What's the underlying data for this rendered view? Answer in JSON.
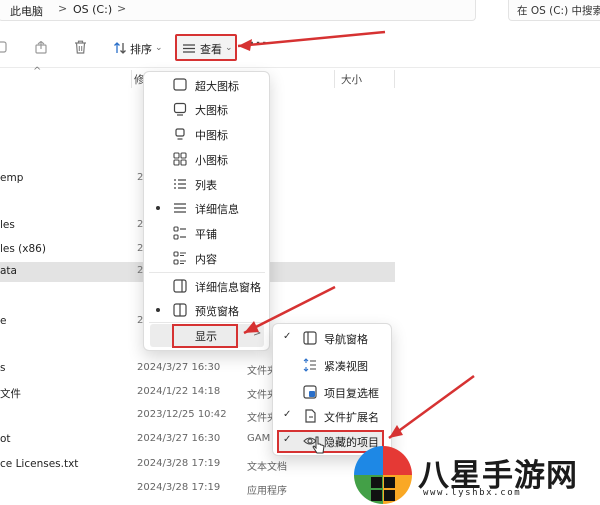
{
  "address": {
    "crumbs": [
      "此电脑",
      "OS (C:)"
    ],
    "separator": ">",
    "search_placeholder": "在 OS (C:) 中搜索"
  },
  "toolbar": {
    "sort_label": "排序",
    "view_label": "查看",
    "more_label": "···"
  },
  "columns": {
    "date_partial": "修",
    "size": "大小"
  },
  "files": [
    {
      "name": "emp",
      "date": "2",
      "type": ""
    },
    {
      "name": "les",
      "date": "2",
      "type": ""
    },
    {
      "name": "les (x86)",
      "date": "2",
      "type": ""
    },
    {
      "name": "ata",
      "date": "2",
      "type": ""
    },
    {
      "name": "e",
      "date": "2",
      "type": ""
    },
    {
      "name": "s",
      "date": "2024/3/27 16:30",
      "type": "文件夹"
    },
    {
      "name": "文件",
      "date": "2024/1/22 14:18",
      "type": "文件夹"
    },
    {
      "name": "",
      "date": "2023/12/25 10:42",
      "type": "文件夹"
    },
    {
      "name": "ot",
      "date": "2024/3/27 16:30",
      "type": "GAM"
    },
    {
      "name": "ce Licenses.txt",
      "date": "2024/3/28 17:19",
      "type": "文本文档"
    },
    {
      "name": "",
      "date": "2024/3/28 17:19",
      "type": "应用程序"
    }
  ],
  "view_menu": {
    "items": [
      {
        "label": "超大图标",
        "icon": "xl-icons-icon",
        "selected": false
      },
      {
        "label": "大图标",
        "icon": "large-icons-icon",
        "selected": false
      },
      {
        "label": "中图标",
        "icon": "medium-icons-icon",
        "selected": false
      },
      {
        "label": "小图标",
        "icon": "small-icons-icon",
        "selected": false
      },
      {
        "label": "列表",
        "icon": "list-icon",
        "selected": false
      },
      {
        "label": "详细信息",
        "icon": "details-icon",
        "selected": true
      },
      {
        "label": "平铺",
        "icon": "tiles-icon",
        "selected": false
      },
      {
        "label": "内容",
        "icon": "content-icon",
        "selected": false
      }
    ],
    "pane_items": [
      {
        "label": "详细信息窗格",
        "icon": "details-pane-icon",
        "selected": false
      },
      {
        "label": "预览窗格",
        "icon": "preview-pane-icon",
        "selected": true
      }
    ],
    "show_label": "显示",
    "show_chevron": ">"
  },
  "show_submenu": {
    "items": [
      {
        "label": "导航窗格",
        "icon": "nav-pane-icon",
        "checked": true
      },
      {
        "label": "紧凑视图",
        "icon": "compact-view-icon",
        "checked": false
      },
      {
        "label": "项目复选框",
        "icon": "checkbox-icon",
        "checked": false
      },
      {
        "label": "文件扩展名",
        "icon": "file-ext-icon",
        "checked": true
      },
      {
        "label": "隐藏的项目",
        "icon": "eye-icon",
        "checked": true
      }
    ]
  },
  "watermark": {
    "text": "八星手游网",
    "url": "www.lyshbx.com"
  },
  "colors": {
    "highlight_red": "#d63232",
    "menu_hover": "#ececec",
    "row_selected": "#e3e3e3"
  }
}
